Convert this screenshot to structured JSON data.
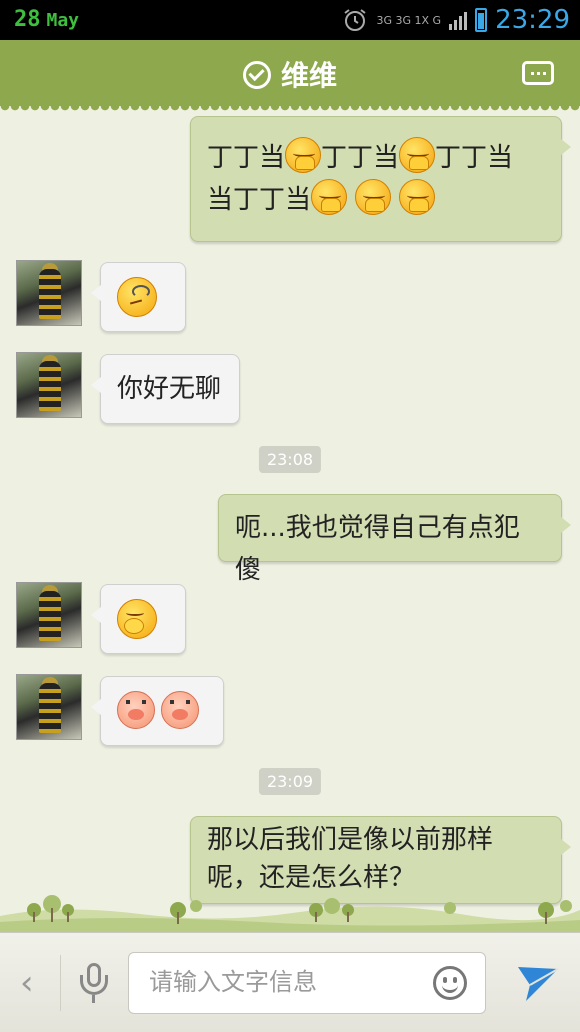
{
  "status_bar": {
    "day": "28",
    "month": "May",
    "network": "3G 3G 1X G",
    "time": "23:29"
  },
  "header": {
    "title": "维维",
    "title_icon": "check-circle-icon",
    "menu_icon": "more-dots-icon",
    "color": "#8ea84e"
  },
  "messages": [
    {
      "side": "right",
      "line1": "丁丁当",
      "line1b": "丁丁当",
      "line1c": "丁丁当",
      "line2a": "当丁丁当",
      "emoji": "shy-face"
    },
    {
      "side": "left",
      "emoji": "thinking-face"
    },
    {
      "side": "left",
      "text": "你好无聊"
    },
    {
      "type": "time",
      "text": "23:08"
    },
    {
      "side": "right",
      "text": "呃...我也觉得自己有点犯傻"
    },
    {
      "side": "left",
      "emoji": "shush-face"
    },
    {
      "side": "left",
      "emoji": "pig-face"
    },
    {
      "type": "time",
      "text": "23:09"
    },
    {
      "side": "right",
      "line1": "那以后我们是像以前那样",
      "line2": "呢，还是怎么样？"
    }
  ],
  "input": {
    "placeholder": "请输入文字信息",
    "value": ""
  },
  "colors": {
    "outgoing_bubble": "#d2ddb2",
    "incoming_bubble": "#f4f4f4",
    "chat_bg": "#eef0e2",
    "send_icon": "#2f86d6"
  }
}
